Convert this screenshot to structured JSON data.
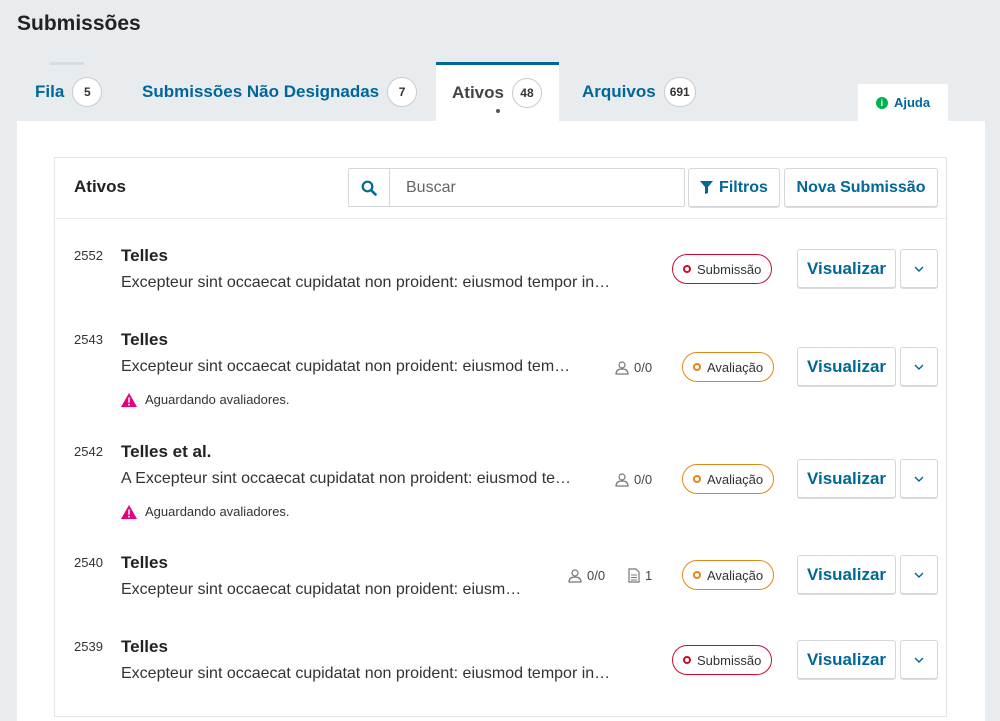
{
  "page": {
    "title": "Submissões"
  },
  "tabs": [
    {
      "label": "Fila",
      "count": "5"
    },
    {
      "label": "Submissões Não Designadas",
      "count": "7"
    },
    {
      "label": "Ativos",
      "count": "48",
      "active": true
    },
    {
      "label": "Arquivos",
      "count": "691"
    }
  ],
  "help": {
    "label": "Ajuda"
  },
  "list": {
    "title": "Ativos",
    "search_placeholder": "Buscar",
    "filters_label": "Filtros",
    "new_submission_label": "Nova Submissão"
  },
  "view_label": "Visualizar",
  "colors": {
    "accent": "#006798",
    "submission": "#d00a2c",
    "review": "#e08914",
    "warning": "#e6007e"
  },
  "submissions": [
    {
      "id": "2552",
      "author": "Telles",
      "title": "Excepteur sint occaecat cupidatat non proident: eiusmod tempor in…",
      "stage": "Submissão"
    },
    {
      "id": "2543",
      "author": "Telles",
      "title": "Excepteur sint occaecat cupidatat non proident: eiusmod tem…",
      "reviewers": "0/0",
      "stage": "Avaliação",
      "warning": "Aguardando avaliadores."
    },
    {
      "id": "2542",
      "author": "Telles et al.",
      "title": "A Excepteur sint occaecat cupidatat non proident: eiusmod te…",
      "reviewers": "0/0",
      "stage": "Avaliação",
      "warning": "Aguardando avaliadores."
    },
    {
      "id": "2540",
      "author": "Telles",
      "title": "Excepteur sint occaecat cupidatat non proident: eiusm…",
      "reviewers": "0/0",
      "files": "1",
      "stage": "Avaliação"
    },
    {
      "id": "2539",
      "author": "Telles",
      "title": "Excepteur sint occaecat cupidatat non proident: eiusmod tempor in…",
      "stage": "Submissão"
    }
  ]
}
